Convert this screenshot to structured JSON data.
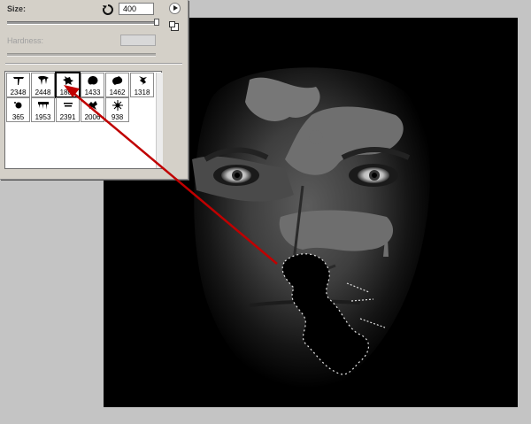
{
  "brush_panel": {
    "size_label": "Size:",
    "size_value": "400",
    "hardness_label": "Hardness:",
    "size_slider_level": 0.95,
    "brushes": [
      {
        "number": "2348",
        "icon": "brush-stroke-icon"
      },
      {
        "number": "2448",
        "icon": "splat-drip-icon"
      },
      {
        "number": "1807",
        "icon": "splatter-icon",
        "selected": true
      },
      {
        "number": "1433",
        "icon": "blob-icon"
      },
      {
        "number": "1462",
        "icon": "splash-icon"
      },
      {
        "number": "1318",
        "icon": "spray-streak-icon"
      },
      {
        "number": "365",
        "icon": "drop-icon"
      },
      {
        "number": "1953",
        "icon": "drip-blot-icon"
      },
      {
        "number": "2391",
        "icon": "small-text-icon"
      },
      {
        "number": "2006",
        "icon": "spatter-icon"
      },
      {
        "number": "938",
        "icon": "burst-icon"
      }
    ]
  },
  "canvas": {
    "content": "black-and-white face with grey paint splatters",
    "arrow_color": "#c00000"
  }
}
